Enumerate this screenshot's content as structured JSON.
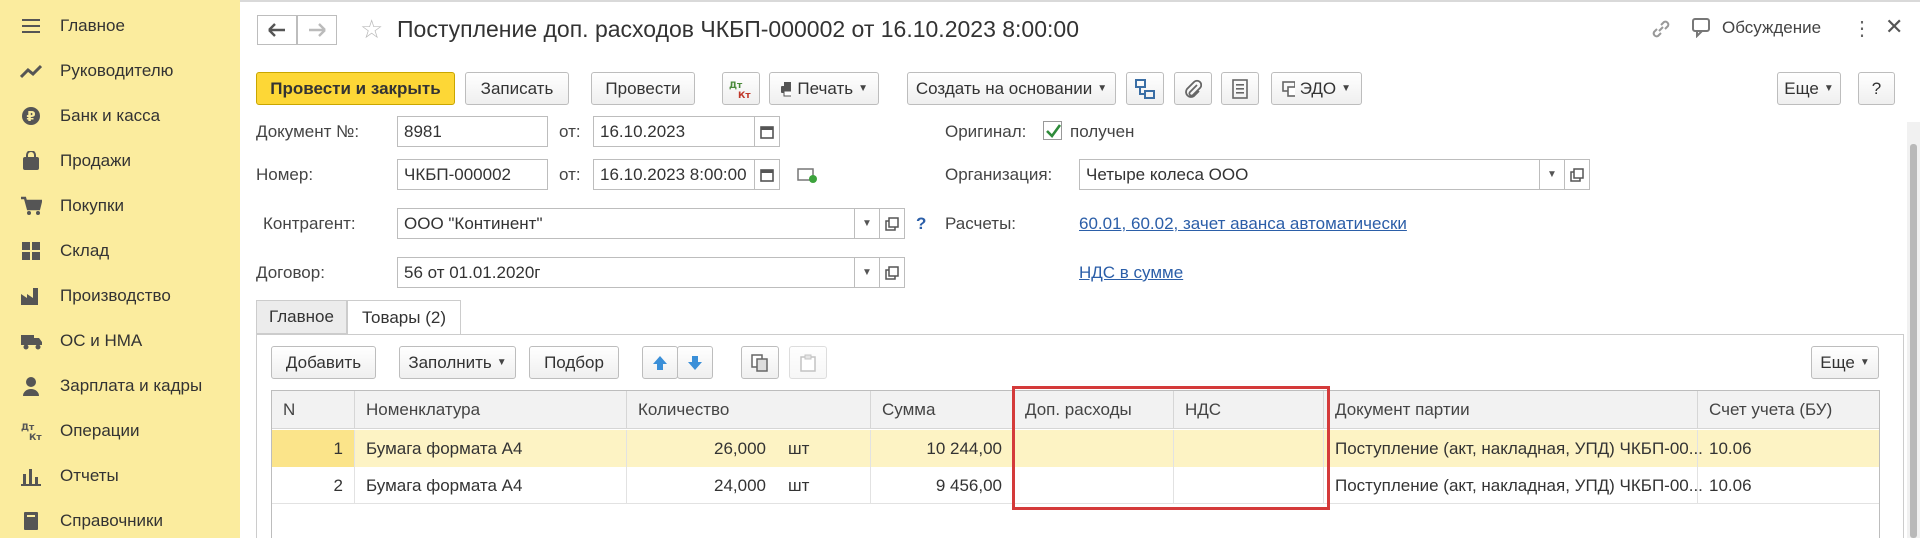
{
  "sidebar": {
    "items": [
      {
        "label": "Главное",
        "icon": "menu-icon"
      },
      {
        "label": "Руководителю",
        "icon": "chart-line-icon"
      },
      {
        "label": "Банк и касса",
        "icon": "ruble-coin-icon"
      },
      {
        "label": "Продажи",
        "icon": "shopping-bag-icon"
      },
      {
        "label": "Покупки",
        "icon": "cart-icon"
      },
      {
        "label": "Склад",
        "icon": "warehouse-icon"
      },
      {
        "label": "Производство",
        "icon": "factory-icon"
      },
      {
        "label": "ОС и НМА",
        "icon": "truck-icon"
      },
      {
        "label": "Зарплата и кадры",
        "icon": "person-icon"
      },
      {
        "label": "Операции",
        "icon": "dt-kt-icon"
      },
      {
        "label": "Отчеты",
        "icon": "bar-chart-icon"
      },
      {
        "label": "Справочники",
        "icon": "book-icon"
      }
    ]
  },
  "header": {
    "title": "Поступление доп. расходов ЧКБП-000002 от 16.10.2023 8:00:00",
    "discussion": "Обсуждение"
  },
  "toolbar": {
    "post_close": "Провести и закрыть",
    "save": "Записать",
    "post": "Провести",
    "dtkt": "Дт Кт",
    "print": "Печать",
    "create_based": "Создать на основании",
    "edo": "ЭДО",
    "more": "Еще",
    "help": "?"
  },
  "form": {
    "doc_no_label": "Документ №:",
    "doc_no": "8981",
    "from_label": "от:",
    "doc_date": "16.10.2023",
    "number_label": "Номер:",
    "number": "ЧКБП-000002",
    "number_date": "16.10.2023  8:00:00",
    "original_label": "Оригинал:",
    "original_value": "получен",
    "org_label": "Организация:",
    "org": "Четыре колеса ООО",
    "counterparty_label": "Контрагент:",
    "counterparty": "ООО \"Континент\"",
    "question": "?",
    "settlements_label": "Расчеты:",
    "settlements_link": "60.01, 60.02, зачет аванса автоматически",
    "contract_label": "Договор:",
    "contract": "56 от 01.01.2020г",
    "vat_link": "НДС в сумме"
  },
  "tabs": [
    {
      "label": "Главное"
    },
    {
      "label": "Товары (2)"
    }
  ],
  "table_toolbar": {
    "add": "Добавить",
    "fill": "Заполнить",
    "pick": "Подбор",
    "more": "Еще"
  },
  "table": {
    "columns": [
      "N",
      "Номенклатура",
      "Количество",
      "Сумма",
      "Доп. расходы",
      "НДС",
      "Документ партии",
      "Счет учета (БУ)"
    ],
    "rows": [
      {
        "n": "1",
        "item": "Бумага формата А4",
        "qty": "26,000",
        "unit": "шт",
        "sum": "10 244,00",
        "extra": "",
        "vat": "",
        "batch": "Поступление (акт, накладная, УПД) ЧКБП-00...",
        "account": "10.06"
      },
      {
        "n": "2",
        "item": "Бумага формата А4",
        "qty": "24,000",
        "unit": "шт",
        "sum": "9 456,00",
        "extra": "",
        "vat": "",
        "batch": "Поступление (акт, накладная, УПД) ЧКБП-00...",
        "account": "10.06"
      }
    ]
  },
  "colors": {
    "sidebar_bg": "#fbec9e",
    "primary_button": "#fdd736",
    "selected_row": "#fdf3c4",
    "highlight_box": "#d43a3a",
    "link": "#2b5ea8"
  }
}
